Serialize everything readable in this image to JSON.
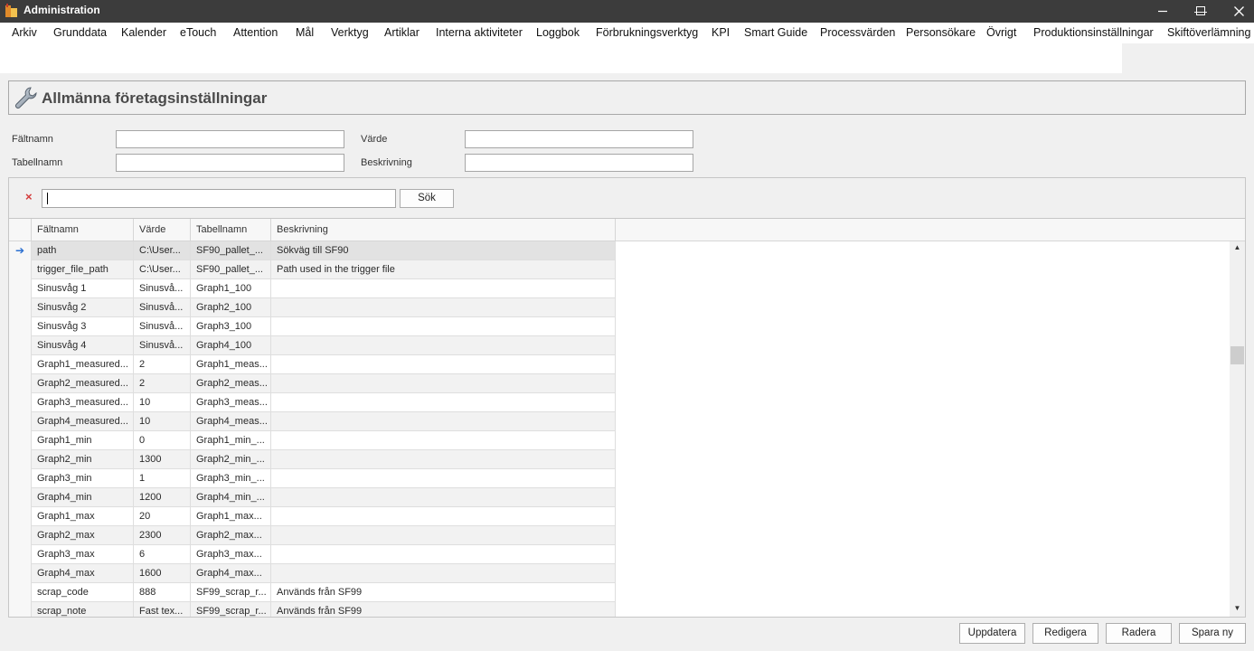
{
  "window": {
    "title": "Administration",
    "minimize_glyph": "—",
    "maximize_glyph": "☐",
    "close_glyph": "✕"
  },
  "menu": [
    "Arkiv",
    "Grunddata",
    "Kalender",
    "eTouch",
    "Attention",
    "Mål",
    "Verktyg",
    "Artiklar",
    "Interna aktiviteter",
    "Loggbok",
    "Förbrukningsverktyg",
    "KPI",
    "Smart Guide",
    "Processvärden",
    "Personsökare",
    "Övrigt",
    "Produktionsinställningar",
    "Skiftöverlämning"
  ],
  "page": {
    "title": "Allmänna företagsinställningar",
    "icon": "wrench-icon"
  },
  "filters": {
    "faltnamn_label": "Fältnamn",
    "tabellnamn_label": "Tabellnamn",
    "varde_label": "Värde",
    "beskrivning_label": "Beskrivning",
    "faltnamn_value": "",
    "tabellnamn_value": "",
    "varde_value": "",
    "beskrivning_value": ""
  },
  "search": {
    "clear_glyph": "×",
    "value": "",
    "button_label": "Sök"
  },
  "grid": {
    "columns": [
      "Fältnamn",
      "Värde",
      "Tabellnamn",
      "Beskrivning"
    ],
    "current_row_glyph": "➔",
    "rows": [
      [
        "path",
        "C:\\User...",
        "SF90_pallet_...",
        "Sökväg till SF90"
      ],
      [
        "trigger_file_path",
        "C:\\User...",
        "SF90_pallet_...",
        "Path used in the trigger file"
      ],
      [
        "Sinusvåg 1",
        "Sinusvå...",
        "Graph1_100",
        ""
      ],
      [
        "Sinusvåg 2",
        "Sinusvå...",
        "Graph2_100",
        ""
      ],
      [
        "Sinusvåg 3",
        "Sinusvå...",
        "Graph3_100",
        ""
      ],
      [
        "Sinusvåg 4",
        "Sinusvå...",
        "Graph4_100",
        ""
      ],
      [
        "Graph1_measured...",
        "2",
        "Graph1_meas...",
        ""
      ],
      [
        "Graph2_measured...",
        "2",
        "Graph2_meas...",
        ""
      ],
      [
        "Graph3_measured...",
        "10",
        "Graph3_meas...",
        ""
      ],
      [
        "Graph4_measured...",
        "10",
        "Graph4_meas...",
        ""
      ],
      [
        "Graph1_min",
        "0",
        "Graph1_min_...",
        ""
      ],
      [
        "Graph2_min",
        "1300",
        "Graph2_min_...",
        ""
      ],
      [
        "Graph3_min",
        "1",
        "Graph3_min_...",
        ""
      ],
      [
        "Graph4_min",
        "1200",
        "Graph4_min_...",
        ""
      ],
      [
        "Graph1_max",
        "20",
        "Graph1_max...",
        ""
      ],
      [
        "Graph2_max",
        "2300",
        "Graph2_max...",
        ""
      ],
      [
        "Graph3_max",
        "6",
        "Graph3_max...",
        ""
      ],
      [
        "Graph4_max",
        "1600",
        "Graph4_max...",
        ""
      ],
      [
        "scrap_code",
        "888",
        "SF99_scrap_r...",
        "Används från SF99"
      ],
      [
        "scrap_note",
        "Fast tex...",
        "SF99_scrap_r...",
        "Används från SF99"
      ]
    ],
    "scroll_up_glyph": "▲",
    "scroll_down_glyph": "▼"
  },
  "buttons": {
    "uppdatera": "Uppdatera",
    "redigera": "Redigera",
    "radera": "Radera",
    "spara_ny": "Spara ny"
  }
}
